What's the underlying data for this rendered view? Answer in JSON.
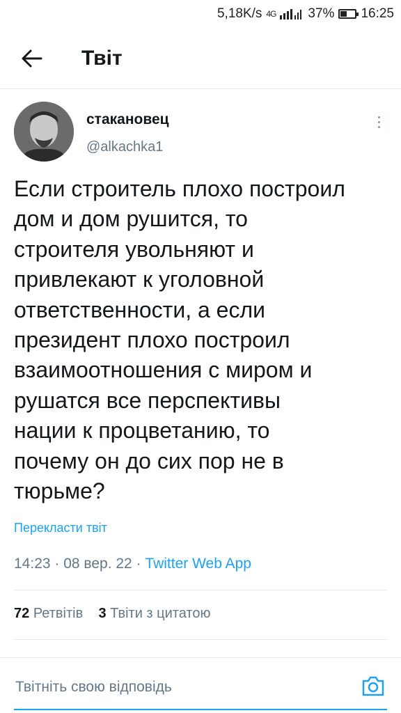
{
  "status_bar": {
    "speed": "5,18K/s",
    "network": "4G",
    "battery": "37%",
    "battery_level": 0.37,
    "time": "16:25"
  },
  "header": {
    "title": "Твіт"
  },
  "author": {
    "name": "стакановец",
    "handle": "@alkachka1"
  },
  "tweet": {
    "lines": [
      "Если строитель плохо построил",
      "дом и дом рушится, то",
      "строителя увольняют и",
      "привлекают к уголовной",
      "ответственности, а если",
      "президент плохо построил",
      "взаимоотношения с миром и",
      "рушатся все перспективы",
      "нации к процветанию, то",
      "почему он до сих пор не в",
      "тюрьме?"
    ],
    "translate_label": "Перекласти твіт",
    "time": "14:23",
    "date": "08 вер. 22",
    "source_app": "Twitter Web App"
  },
  "stats": {
    "retweets_count": "72",
    "retweets_label": "Ретвітів",
    "quotes_count": "3",
    "quotes_label": "Твіти з цитатою"
  },
  "reply": {
    "placeholder": "Твітніть свою відповідь"
  },
  "icons": {
    "back": "arrow-left-icon",
    "more": "more-vertical-icon",
    "camera": "camera-icon",
    "signal": "signal-icon",
    "battery": "battery-icon"
  },
  "colors": {
    "accent": "#1da1f2",
    "secondary_text": "#657786",
    "divider": "#e6ecf0"
  }
}
